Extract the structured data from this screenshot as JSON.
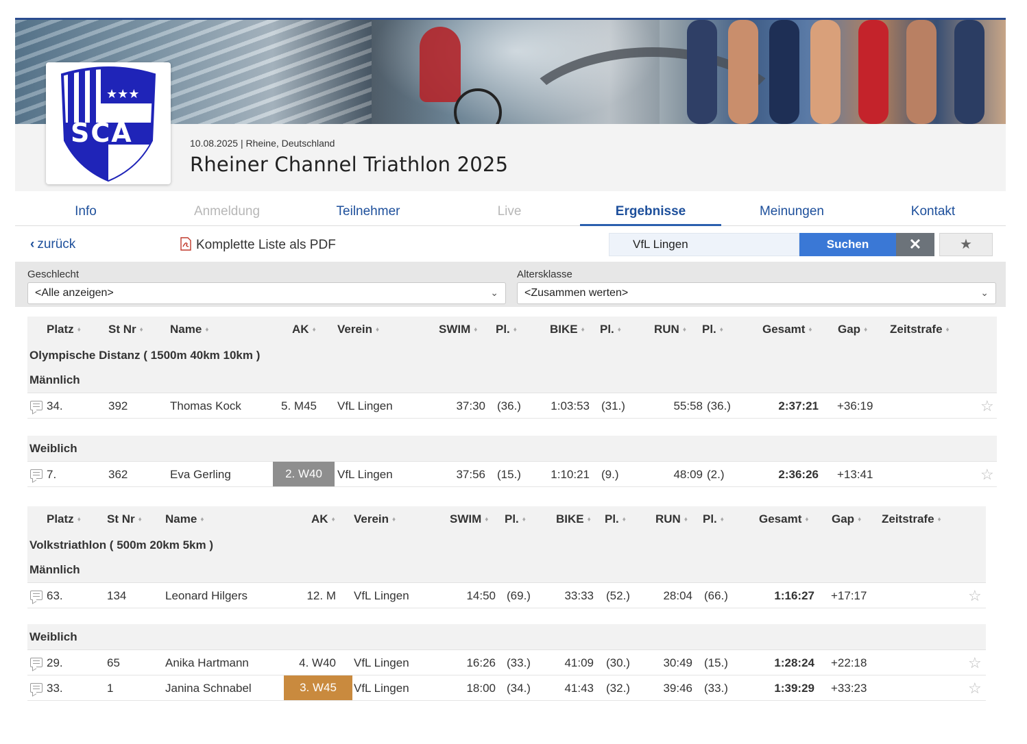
{
  "header": {
    "date_location": "10.08.2025 | Rheine, Deutschland",
    "title": "Rheiner Channel Triathlon 2025",
    "logo_text": "SCA"
  },
  "tabs": [
    {
      "label": "Info",
      "state": "normal"
    },
    {
      "label": "Anmeldung",
      "state": "disabled"
    },
    {
      "label": "Teilnehmer",
      "state": "normal"
    },
    {
      "label": "Live",
      "state": "disabled"
    },
    {
      "label": "Ergebnisse",
      "state": "active"
    },
    {
      "label": "Meinungen",
      "state": "normal"
    },
    {
      "label": "Kontakt",
      "state": "normal"
    }
  ],
  "toolbar": {
    "back_label": "zurück",
    "pdf_label": "Komplette Liste als PDF",
    "search_value": "VfL Lingen",
    "search_button": "Suchen",
    "clear_icon": "close-icon",
    "fav_icon": "star-icon"
  },
  "filters": {
    "gender_label": "Geschlecht",
    "gender_value": "<Alle anzeigen>",
    "age_label": "Altersklasse",
    "age_value": "<Zusammen werten>"
  },
  "columns": [
    "Platz",
    "St Nr",
    "Name",
    "AK",
    "Verein",
    "SWIM",
    "Pl.",
    "BIKE",
    "Pl.",
    "RUN",
    "Pl.",
    "Gesamt",
    "Gap",
    "Zeitstrafe"
  ],
  "olympic": {
    "distance": "Olympische Distanz ( 1500m 40km 10km )",
    "groups": [
      {
        "name": "Männlich",
        "rows": [
          {
            "platz": "34.",
            "stnr": "392",
            "name": "Thomas Kock",
            "ak": "5. M45",
            "verein": "VfL Lingen",
            "swim": "37:30",
            "swim_pl": "(36.)",
            "bike": "1:03:53",
            "bike_pl": "(31.)",
            "run": "55:58",
            "run_pl": "(36.)",
            "gesamt": "2:37:21",
            "gap": "+36:19",
            "badge": ""
          }
        ]
      },
      {
        "name": "Weiblich",
        "rows": [
          {
            "platz": "7.",
            "stnr": "362",
            "name": "Eva Gerling",
            "ak": "2. W40",
            "verein": "VfL Lingen",
            "swim": "37:56",
            "swim_pl": "(15.)",
            "bike": "1:10:21",
            "bike_pl": "(9.)",
            "run": "48:09",
            "run_pl": "(2.)",
            "gesamt": "2:36:26",
            "gap": "+13:41",
            "badge": "silver"
          }
        ]
      }
    ]
  },
  "volks": {
    "distance": "Volkstriathlon ( 500m 20km 5km )",
    "groups": [
      {
        "name": "Männlich",
        "rows": [
          {
            "platz": "63.",
            "stnr": "134",
            "name": "Leonard Hilgers",
            "ak": "12. M",
            "verein": "VfL Lingen",
            "swim": "14:50",
            "swim_pl": "(69.)",
            "bike": "33:33",
            "bike_pl": "(52.)",
            "run": "28:04",
            "run_pl": "(66.)",
            "gesamt": "1:16:27",
            "gap": "+17:17",
            "badge": ""
          }
        ]
      },
      {
        "name": "Weiblich",
        "rows": [
          {
            "platz": "29.",
            "stnr": "65",
            "name": "Anika Hartmann",
            "ak": "4. W40",
            "verein": "VfL Lingen",
            "swim": "16:26",
            "swim_pl": "(33.)",
            "bike": "41:09",
            "bike_pl": "(30.)",
            "run": "30:49",
            "run_pl": "(15.)",
            "gesamt": "1:28:24",
            "gap": "+22:18",
            "badge": ""
          },
          {
            "platz": "33.",
            "stnr": "1",
            "name": "Janina Schnabel",
            "ak": "3. W45",
            "verein": "VfL Lingen",
            "swim": "18:00",
            "swim_pl": "(34.)",
            "bike": "41:43",
            "bike_pl": "(32.)",
            "run": "39:46",
            "run_pl": "(33.)",
            "gesamt": "1:39:29",
            "gap": "+33:23",
            "badge": "bronze"
          }
        ]
      }
    ]
  },
  "colors": {
    "accent": "#1d4f9b",
    "search_button": "#3a78d6",
    "silver_badge": "#8e8e8e",
    "bronze_badge": "#c98a3e",
    "logo_blue": "#1f24b8"
  }
}
